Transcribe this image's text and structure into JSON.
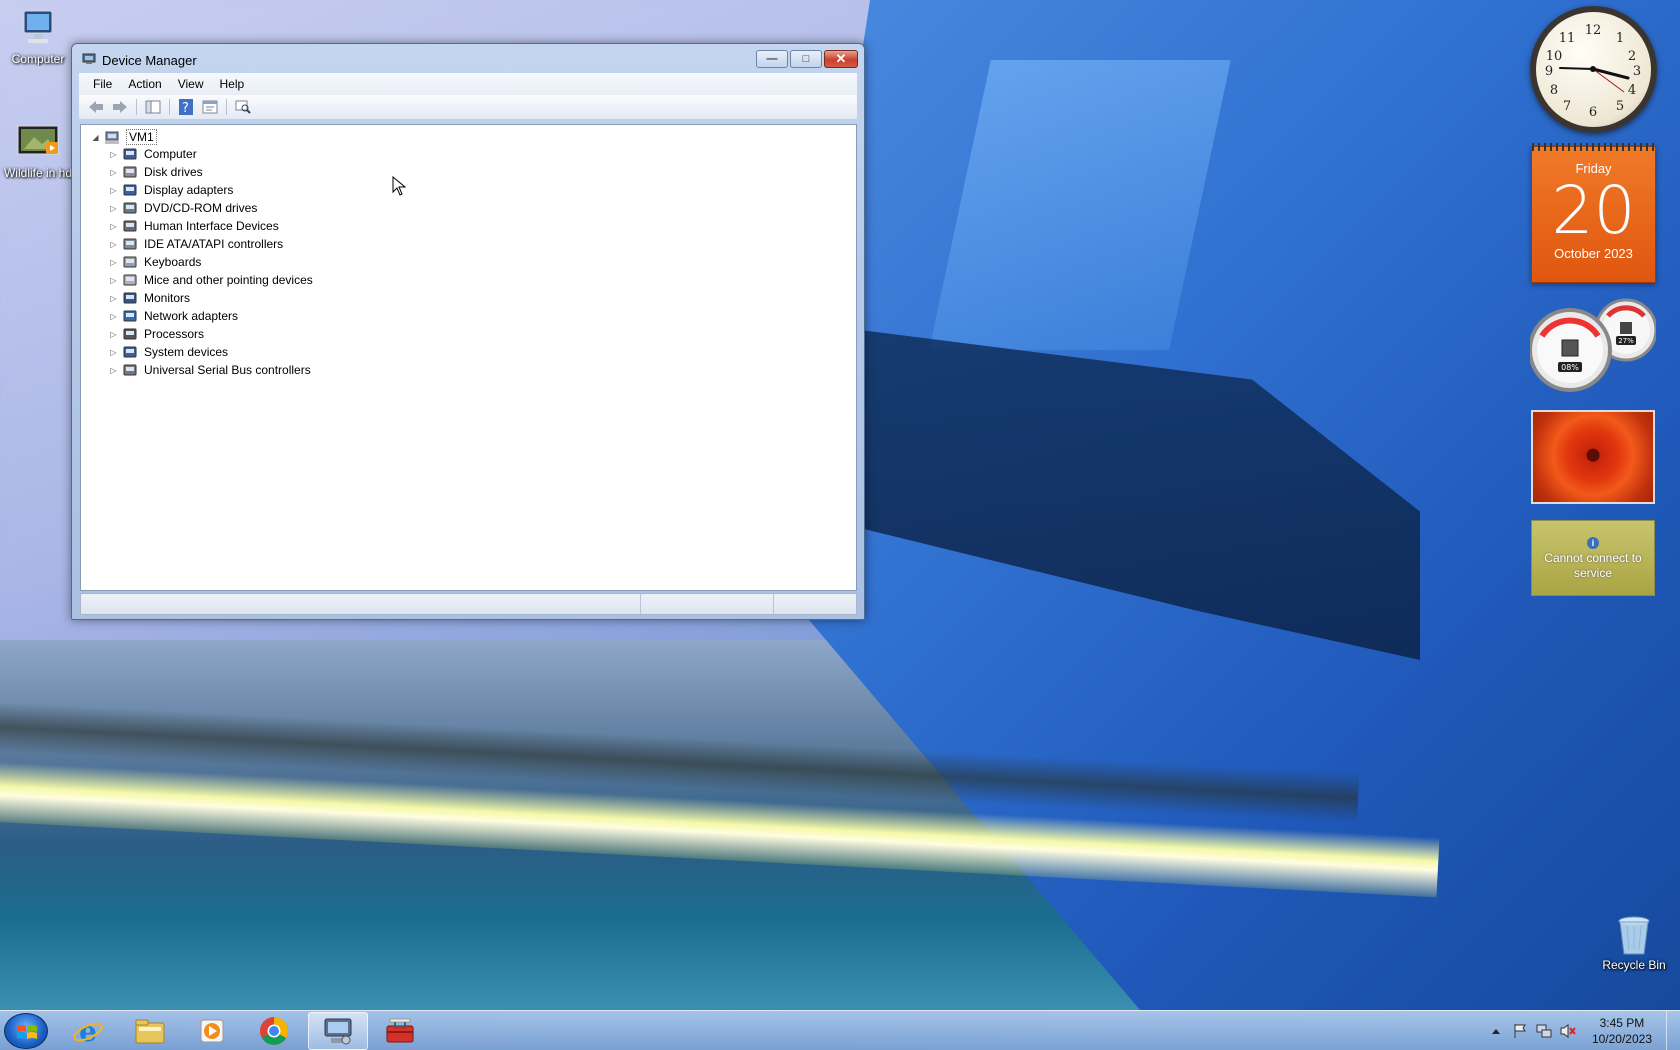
{
  "desktop": {
    "icons": [
      {
        "label": "Computer"
      },
      {
        "label": "Wildlife in hd"
      },
      {
        "label": "Recycle Bin"
      }
    ]
  },
  "window": {
    "title": "Device Manager",
    "menu": [
      "File",
      "Action",
      "View",
      "Help"
    ],
    "tree": {
      "root": "VM1",
      "categories": [
        "Computer",
        "Disk drives",
        "Display adapters",
        "DVD/CD-ROM drives",
        "Human Interface Devices",
        "IDE ATA/ATAPI controllers",
        "Keyboards",
        "Mice and other pointing devices",
        "Monitors",
        "Network adapters",
        "Processors",
        "System devices",
        "Universal Serial Bus controllers"
      ]
    },
    "toolbar_icons": [
      "back-icon",
      "forward-icon",
      "show-hide-console-tree-icon",
      "help-icon",
      "properties-icon",
      "scan-hardware-icon"
    ]
  },
  "gadgets": {
    "calendar": {
      "day_name": "Friday",
      "day": "20",
      "month_year": "October 2023"
    },
    "cpu_meter": {
      "cpu": "08%",
      "memory": "27%"
    },
    "weather": {
      "message": "Cannot connect to service"
    }
  },
  "taskbar": {
    "apps": [
      "internet-explorer-icon",
      "file-explorer-icon",
      "media-player-icon",
      "chrome-icon",
      "device-manager-icon",
      "toolbox-icon"
    ],
    "time": "3:45 PM",
    "date": "10/20/2023"
  },
  "colors": {
    "calendar_orange": "#e8661a",
    "close_red": "#c8412c",
    "taskbar": "#8fb2dd"
  }
}
